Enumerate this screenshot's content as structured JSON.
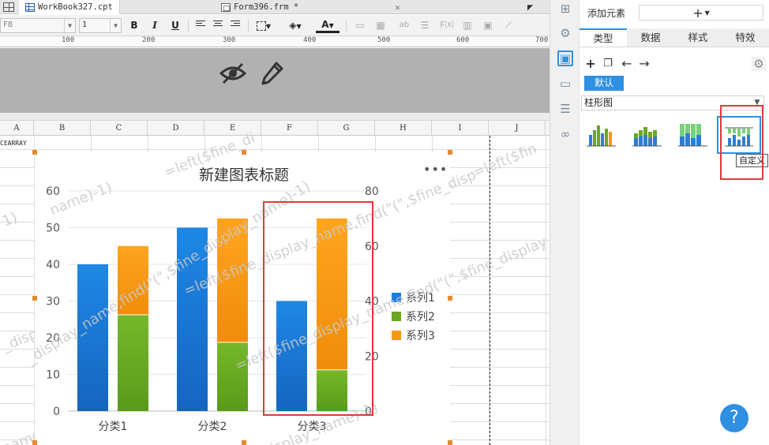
{
  "tabs": [
    {
      "label": "WorkBook327.cpt",
      "icon": "spreadsheet-icon"
    },
    {
      "label": "Form396.frm *",
      "icon": "form-icon"
    }
  ],
  "toolbar": {
    "font_name": "FB",
    "font_size": "1",
    "bold_label": "B",
    "italic_label": "I",
    "underline_label": "U",
    "text_color_label": "A"
  },
  "ruler": {
    "marks": [
      "100",
      "200",
      "300",
      "400",
      "500",
      "600",
      "700"
    ]
  },
  "columns": [
    "A",
    "B",
    "C",
    "D",
    "E",
    "F",
    "G",
    "H",
    "I",
    "J"
  ],
  "cell_a1": "CEARRAY",
  "watermark": {
    "text_a": "=left($fine_di",
    "text_b": "name)-1)",
    "text_c": "_display_name)-1)",
    "text_d": "=left($fine_display_name,find(\"(\",$fine_disp",
    "text_e": "=left($fine_display_name,find(\"(\",$fine_display",
    "text_f": "=left($fin",
    "text_g": "_display_name,find(\"(\",$fine_display_name)-1)",
    "text_h": "isplay_name)-1)",
    "text_i": "1)"
  },
  "chart_data": {
    "type": "bar",
    "title": "新建图表标题",
    "categories": [
      "分类1",
      "分类2",
      "分类3"
    ],
    "series": [
      {
        "name": "系列1",
        "axis": "left",
        "values": [
          40,
          50,
          30
        ],
        "color": "#1a7fd9"
      },
      {
        "name": "系列2",
        "axis": "right",
        "stack": "s",
        "values": [
          35,
          25,
          15
        ],
        "color": "#6aa721"
      },
      {
        "name": "系列3",
        "axis": "right",
        "stack": "s",
        "values": [
          25,
          45,
          55
        ],
        "color": "#f39c12"
      }
    ],
    "y_left": {
      "ticks": [
        "0",
        "10",
        "20",
        "30",
        "40",
        "50",
        "60"
      ],
      "ylim": [
        0,
        60
      ]
    },
    "y_right": {
      "ticks": [
        "0",
        "20",
        "40",
        "60",
        "80"
      ],
      "ylim": [
        0,
        80
      ]
    },
    "legend": "right",
    "menu_label": "•••"
  },
  "panel": {
    "add_element_label": "添加元素",
    "add_element_button": "+",
    "tabs": [
      "类型",
      "数据",
      "样式",
      "特效"
    ],
    "active_tab": "类型",
    "default_label": "默认",
    "chart_type": "柱形图",
    "thumbnail_tooltip": "自定义",
    "help_label": "?"
  },
  "colors": {
    "accent": "#2f8fe0",
    "highlight": "#e03a3a",
    "series1": "#1a7fd9",
    "series2": "#6aa721",
    "series3": "#f39c12"
  }
}
